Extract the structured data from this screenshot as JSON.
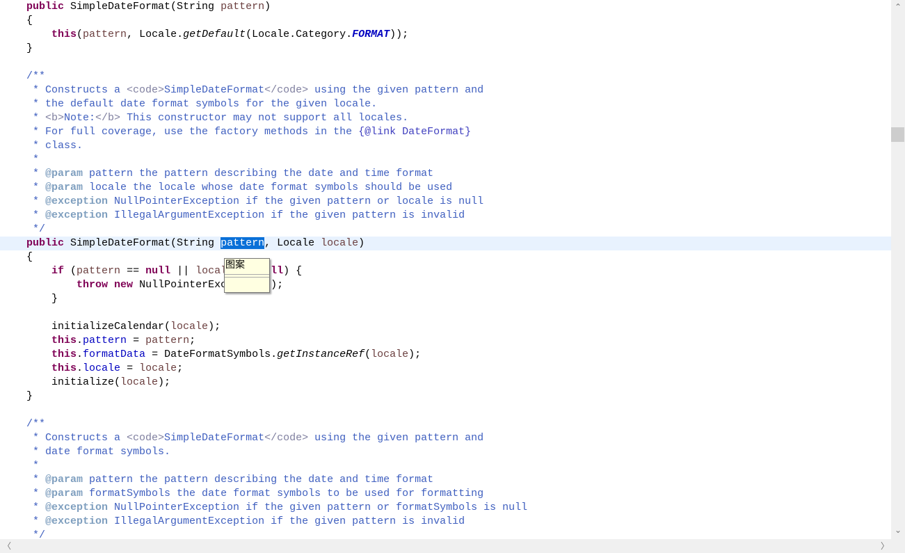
{
  "editor": {
    "current_line": 17,
    "lines": [
      [
        [
          "k",
          "public"
        ],
        [
          "t",
          " SimpleDateFormat(String "
        ],
        [
          "p",
          "pattern"
        ],
        [
          "t",
          ")"
        ]
      ],
      [
        [
          "t",
          "{"
        ]
      ],
      [
        [
          "t",
          "    "
        ],
        [
          "k",
          "this"
        ],
        [
          "t",
          "("
        ],
        [
          "p",
          "pattern"
        ],
        [
          "t",
          ", Locale."
        ],
        [
          "m",
          "getDefault"
        ],
        [
          "t",
          "(Locale.Category."
        ],
        [
          "fs",
          "FORMAT"
        ],
        [
          "t",
          "));"
        ]
      ],
      [
        [
          "t",
          "}"
        ]
      ],
      [],
      [
        [
          "jd",
          "/**"
        ]
      ],
      [
        [
          "jd",
          " * Constructs a "
        ],
        [
          "jt",
          "<code>"
        ],
        [
          "jd",
          "SimpleDateFormat"
        ],
        [
          "jt",
          "</code>"
        ],
        [
          "jd",
          " using the given pattern and"
        ]
      ],
      [
        [
          "jd",
          " * the default date format symbols for the given locale."
        ]
      ],
      [
        [
          "jd",
          " * "
        ],
        [
          "jt",
          "<b>"
        ],
        [
          "jd",
          "Note:"
        ],
        [
          "jt",
          "</b>"
        ],
        [
          "jd",
          " This constructor may not support all locales."
        ]
      ],
      [
        [
          "jd",
          " * For full coverage, use the factory methods in the "
        ],
        [
          "jl",
          "{@link DateFormat}"
        ]
      ],
      [
        [
          "jd",
          " * class."
        ]
      ],
      [
        [
          "jd",
          " *"
        ]
      ],
      [
        [
          "jd",
          " * "
        ],
        [
          "ja",
          "@param"
        ],
        [
          "jd",
          " pattern the pattern describing the date and time format"
        ]
      ],
      [
        [
          "jd",
          " * "
        ],
        [
          "ja",
          "@param"
        ],
        [
          "jd",
          " locale the locale whose date format symbols should be used"
        ]
      ],
      [
        [
          "jd",
          " * "
        ],
        [
          "ja",
          "@exception"
        ],
        [
          "jd",
          " NullPointerException if the given pattern or locale is null"
        ]
      ],
      [
        [
          "jd",
          " * "
        ],
        [
          "ja",
          "@exception"
        ],
        [
          "jd",
          " IllegalArgumentException if the given pattern is invalid"
        ]
      ],
      [
        [
          "jd",
          " */"
        ]
      ],
      [
        [
          "k",
          "public"
        ],
        [
          "t",
          " SimpleDateFormat(String "
        ],
        [
          "sel",
          "pattern"
        ],
        [
          "t",
          ", Locale "
        ],
        [
          "p",
          "locale"
        ],
        [
          "t",
          ")"
        ]
      ],
      [
        [
          "t",
          "{"
        ]
      ],
      [
        [
          "t",
          "    "
        ],
        [
          "k",
          "if"
        ],
        [
          "t",
          " ("
        ],
        [
          "p",
          "pattern"
        ],
        [
          "t",
          " == "
        ],
        [
          "k",
          "null"
        ],
        [
          "t",
          " || "
        ],
        [
          "p",
          "locale"
        ],
        [
          "t",
          " == "
        ],
        [
          "k",
          "null"
        ],
        [
          "t",
          ") {"
        ]
      ],
      [
        [
          "t",
          "        "
        ],
        [
          "k",
          "throw"
        ],
        [
          "t",
          " "
        ],
        [
          "k",
          "new"
        ],
        [
          "t",
          " NullPointerException();"
        ]
      ],
      [
        [
          "t",
          "    }"
        ]
      ],
      [],
      [
        [
          "t",
          "    initializeCalendar("
        ],
        [
          "p",
          "locale"
        ],
        [
          "t",
          ");"
        ]
      ],
      [
        [
          "t",
          "    "
        ],
        [
          "k",
          "this"
        ],
        [
          "t",
          "."
        ],
        [
          "f",
          "pattern"
        ],
        [
          "t",
          " = "
        ],
        [
          "p",
          "pattern"
        ],
        [
          "t",
          ";"
        ]
      ],
      [
        [
          "t",
          "    "
        ],
        [
          "k",
          "this"
        ],
        [
          "t",
          "."
        ],
        [
          "f",
          "formatData"
        ],
        [
          "t",
          " = DateFormatSymbols."
        ],
        [
          "m",
          "getInstanceRef"
        ],
        [
          "t",
          "("
        ],
        [
          "p",
          "locale"
        ],
        [
          "t",
          ");"
        ]
      ],
      [
        [
          "t",
          "    "
        ],
        [
          "k",
          "this"
        ],
        [
          "t",
          "."
        ],
        [
          "f",
          "locale"
        ],
        [
          "t",
          " = "
        ],
        [
          "p",
          "locale"
        ],
        [
          "t",
          ";"
        ]
      ],
      [
        [
          "t",
          "    initialize("
        ],
        [
          "p",
          "locale"
        ],
        [
          "t",
          ");"
        ]
      ],
      [
        [
          "t",
          "}"
        ]
      ],
      [],
      [
        [
          "jd",
          "/**"
        ]
      ],
      [
        [
          "jd",
          " * Constructs a "
        ],
        [
          "jt",
          "<code>"
        ],
        [
          "jd",
          "SimpleDateFormat"
        ],
        [
          "jt",
          "</code>"
        ],
        [
          "jd",
          " using the given pattern and"
        ]
      ],
      [
        [
          "jd",
          " * date format symbols."
        ]
      ],
      [
        [
          "jd",
          " *"
        ]
      ],
      [
        [
          "jd",
          " * "
        ],
        [
          "ja",
          "@param"
        ],
        [
          "jd",
          " pattern the pattern describing the date and time format"
        ]
      ],
      [
        [
          "jd",
          " * "
        ],
        [
          "ja",
          "@param"
        ],
        [
          "jd",
          " formatSymbols the date format symbols to be used for formatting"
        ]
      ],
      [
        [
          "jd",
          " * "
        ],
        [
          "ja",
          "@exception"
        ],
        [
          "jd",
          " NullPointerException if the given pattern or formatSymbols is null"
        ]
      ],
      [
        [
          "jd",
          " * "
        ],
        [
          "ja",
          "@exception"
        ],
        [
          "jd",
          " IllegalArgumentException if the given pattern is invalid"
        ]
      ],
      [
        [
          "jd",
          " */"
        ]
      ]
    ]
  },
  "tooltip": {
    "text": "图案"
  },
  "scrollbars": {
    "up_icon": "chevron-up-icon",
    "up_glyph": "⌃",
    "down_icon": "chevron-down-icon",
    "down_glyph": "⌄",
    "left_icon": "chevron-left-icon",
    "left_glyph": "〈",
    "right_icon": "chevron-right-icon",
    "right_glyph": "〉"
  },
  "colors": {
    "keyword": "#7f0055",
    "javadoc": "#3f5fbf",
    "field": "#0000c0",
    "selection": "#0a70d8",
    "current_line": "#e8f2fe"
  }
}
